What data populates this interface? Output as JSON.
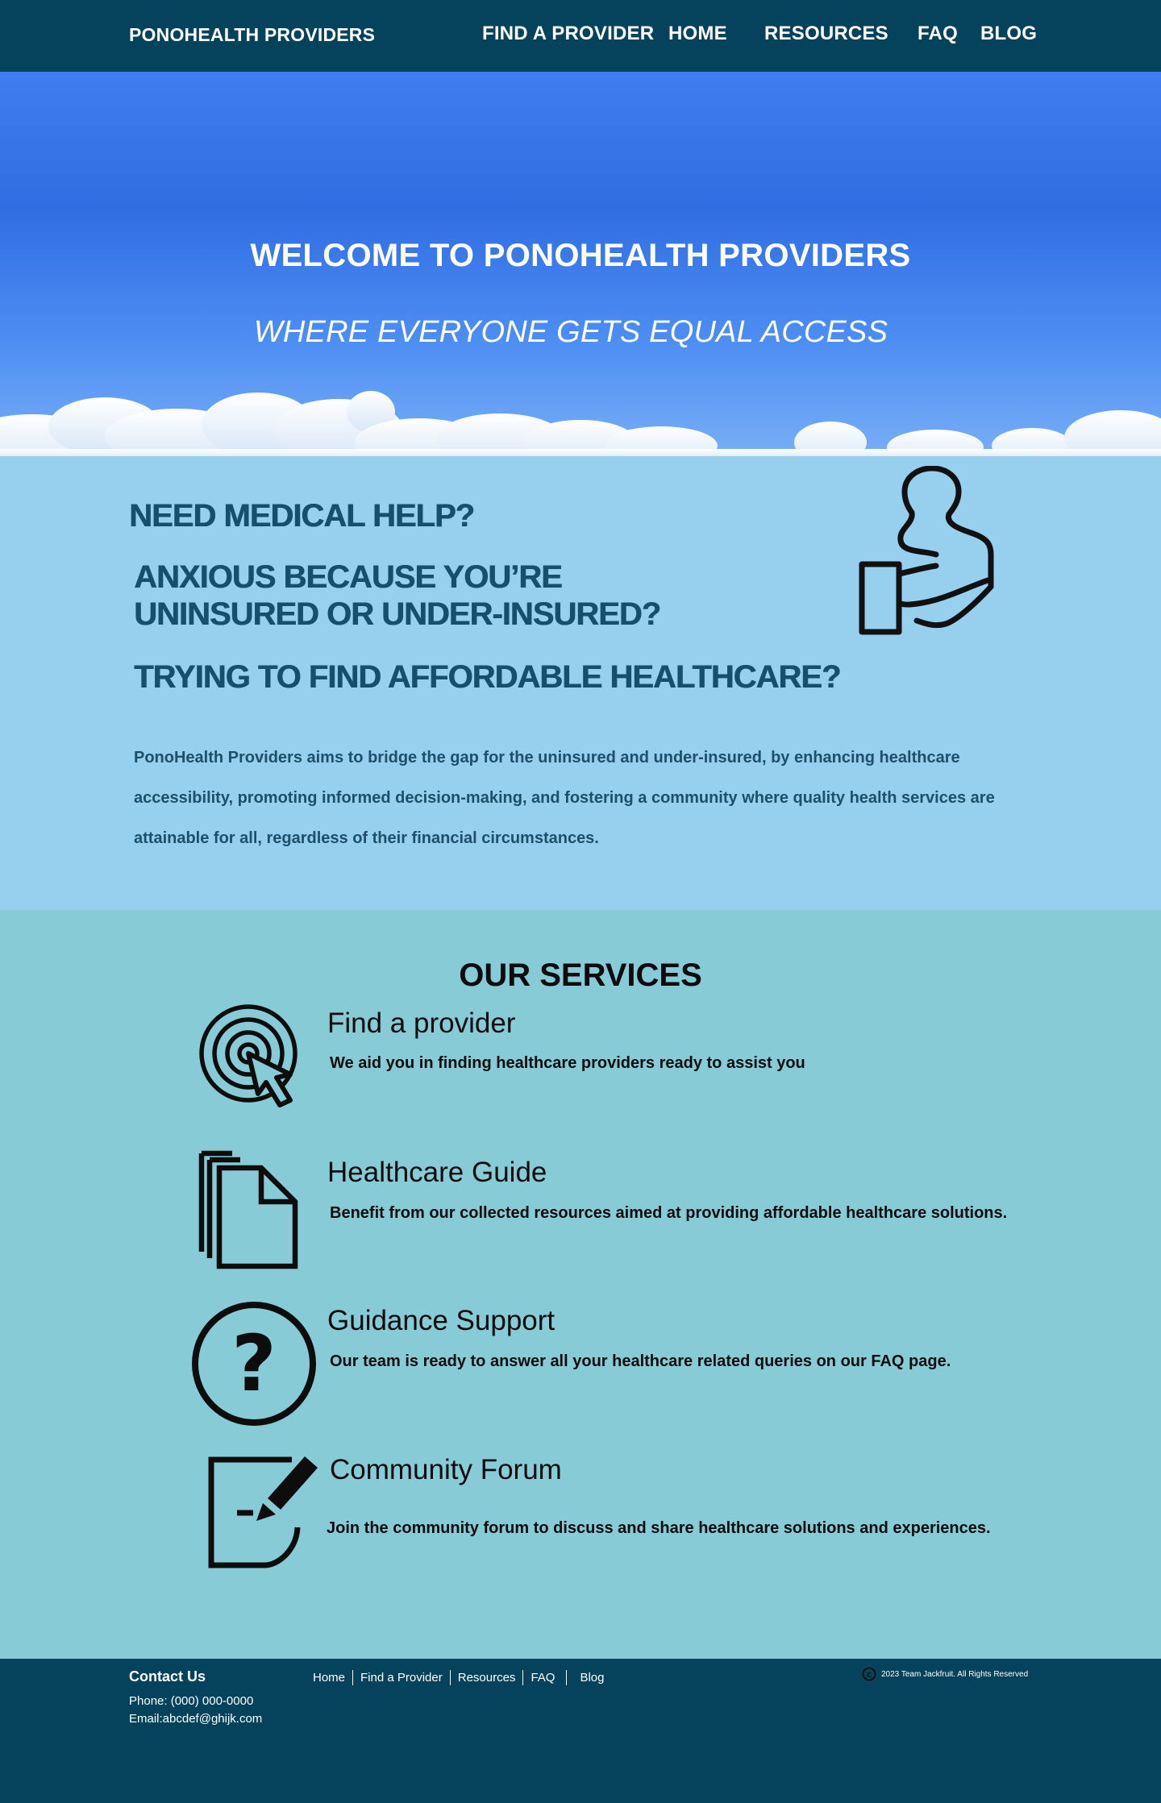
{
  "header": {
    "brand": "PONOHEALTH PROVIDERS",
    "nav": [
      "FIND A PROVIDER",
      "HOME",
      "RESOURCES",
      "FAQ",
      "BLOG"
    ]
  },
  "hero": {
    "title": "WELCOME TO PONOHEALTH PROVIDERS",
    "subtitle": "WHERE EVERYONE GETS EQUAL ACCESS"
  },
  "help": {
    "q1": "NEED MEDICAL HELP?",
    "q2": "ANXIOUS BECAUSE YOU’RE UNINSURED OR UNDER-INSURED?",
    "q3": "TRYING TO FIND AFFORDABLE HEALTHCARE?",
    "lead": "PonoHealth Providers aims to bridge the gap for the uninsured and under-insured, by enhancing healthcare accessibility, promoting informed decision-making, and fostering a community where quality health services are attainable for all, regardless of their financial circumstances.",
    "icon": "hand-holding-person-icon"
  },
  "services": {
    "heading": "OUR SERVICES",
    "items": [
      {
        "title": "Find a provider",
        "desc": "We aid you in finding healthcare providers ready to assist you",
        "icon": "target-cursor-icon"
      },
      {
        "title": "Healthcare Guide",
        "desc": "Benefit from our collected resources aimed at providing affordable healthcare solutions.",
        "icon": "documents-icon"
      },
      {
        "title": "Guidance Support",
        "desc": "Our team is ready to answer all your healthcare related queries on our FAQ page.",
        "icon": "question-circle-icon"
      },
      {
        "title": "Community Forum",
        "desc": "Join the community forum to discuss and share healthcare solutions and experiences.",
        "icon": "edit-document-icon"
      }
    ]
  },
  "footer": {
    "contact_title": "Contact Us",
    "phone": "Phone: (000) 000-0000",
    "email": "Email:abcdef@ghijk.com",
    "links": [
      "Home",
      "Find a Provider",
      "Resources",
      "FAQ",
      "Blog"
    ],
    "copyright": "2023 Team Jackfruit. All Rights Reserved"
  },
  "colors": {
    "header_bg": "#05425c",
    "help_bg": "#97d0ee",
    "help_text": "#174e6d",
    "services_bg": "#87cbd7"
  }
}
